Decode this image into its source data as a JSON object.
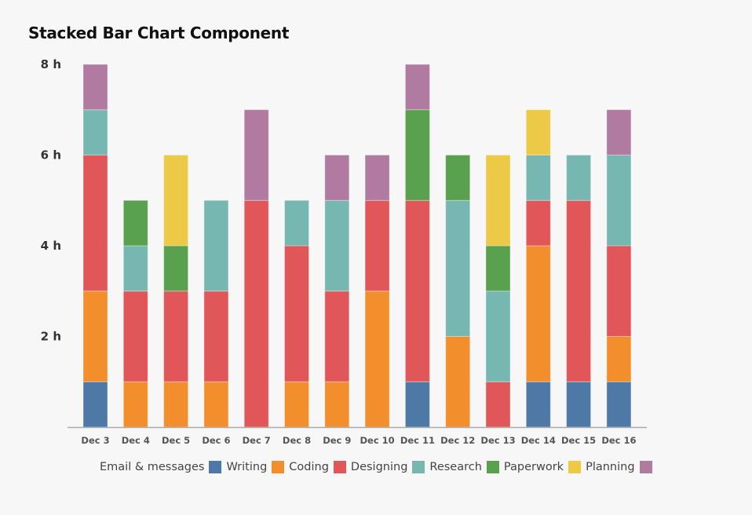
{
  "title": "Stacked Bar Chart Component",
  "chart_data": {
    "type": "bar",
    "stacked": true,
    "title": "Stacked Bar Chart Component",
    "xlabel": "",
    "ylabel": "",
    "ylim": [
      0,
      8
    ],
    "yticks": [
      2,
      4,
      6,
      8
    ],
    "ytick_labels": [
      "2 h",
      "4 h",
      "6 h",
      "8 h"
    ],
    "grid": false,
    "legend_position": "bottom",
    "categories": [
      "Dec 3",
      "Dec 4",
      "Dec 5",
      "Dec 6",
      "Dec 7",
      "Dec 8",
      "Dec 9",
      "Dec 10",
      "Dec 11",
      "Dec 12",
      "Dec 13",
      "Dec 14",
      "Dec 15",
      "Dec 16"
    ],
    "series": [
      {
        "name": "Email & messages",
        "color": "#4e79a7",
        "values": [
          1,
          0,
          0,
          0,
          0,
          0,
          0,
          0,
          1,
          0,
          0,
          1,
          1,
          1
        ]
      },
      {
        "name": "Writing",
        "color": "#f28e2b",
        "values": [
          2,
          1,
          1,
          1,
          0,
          1,
          1,
          3,
          0,
          2,
          0,
          3,
          0,
          1
        ]
      },
      {
        "name": "Coding",
        "color": "#e15759",
        "values": [
          3,
          2,
          2,
          2,
          5,
          3,
          2,
          2,
          4,
          0,
          1,
          1,
          4,
          2
        ]
      },
      {
        "name": "Designing",
        "color": "#76b7b2",
        "values": [
          1,
          1,
          0,
          2,
          0,
          1,
          2,
          0,
          0,
          3,
          2,
          1,
          1,
          2
        ]
      },
      {
        "name": "Research",
        "color": "#59a14f",
        "values": [
          0,
          1,
          1,
          0,
          0,
          0,
          0,
          0,
          2,
          1,
          1,
          0,
          0,
          0
        ]
      },
      {
        "name": "Paperwork",
        "color": "#edc948",
        "values": [
          0,
          0,
          2,
          0,
          0,
          0,
          0,
          0,
          0,
          0,
          2,
          1,
          0,
          0
        ]
      },
      {
        "name": "Planning",
        "color": "#b07aa1",
        "values": [
          1,
          0,
          0,
          0,
          2,
          0,
          1,
          1,
          1,
          0,
          0,
          0,
          0,
          1
        ]
      }
    ]
  }
}
